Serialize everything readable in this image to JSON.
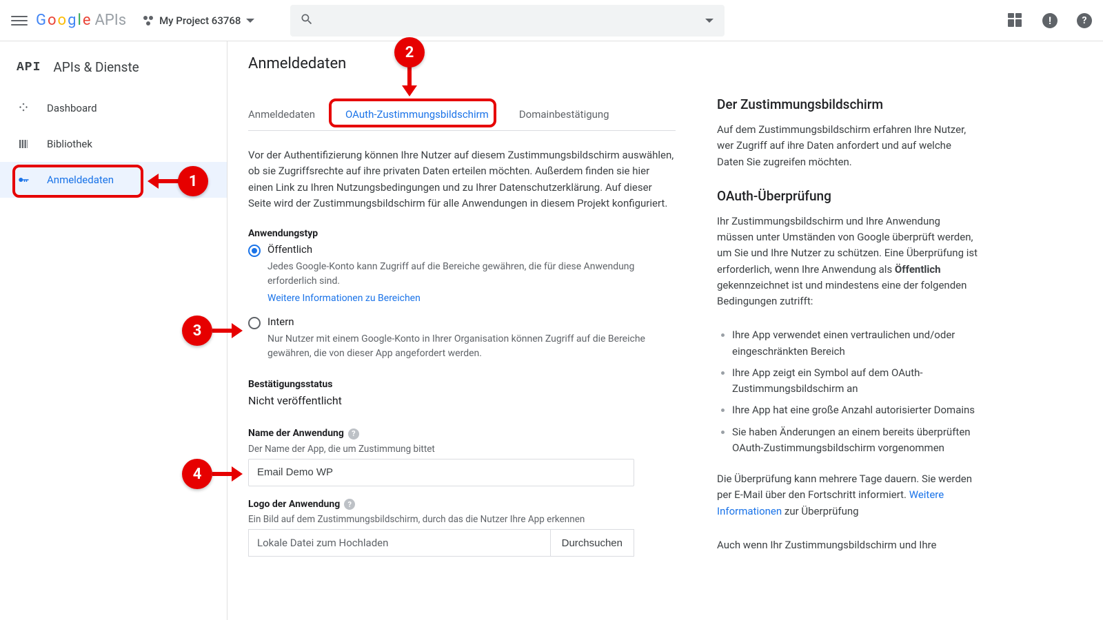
{
  "header": {
    "logo_text": "Google",
    "apis_text": "APIs",
    "project_name": "My Project 63768"
  },
  "sidebar": {
    "section": "APIs & Dienste",
    "items": [
      {
        "label": "Dashboard"
      },
      {
        "label": "Bibliothek"
      },
      {
        "label": "Anmeldedaten"
      }
    ]
  },
  "page": {
    "title": "Anmeldedaten",
    "tabs": [
      {
        "label": "Anmeldedaten"
      },
      {
        "label": "OAuth-Zustimmungsbildschirm"
      },
      {
        "label": "Domainbestätigung"
      }
    ],
    "intro": "Vor der Authentifizierung können Ihre Nutzer auf diesem Zustimmungsbildschirm auswählen, ob sie Zugriffsrechte auf ihre privaten Daten erteilen möchten. Außerdem finden sie hier einen Link zu Ihren Nutzungsbedingungen und zu Ihrer Datenschutzerklärung. Auf dieser Seite wird der Zustimmungsbildschirm für alle Anwendungen in diesem Projekt konfiguriert.",
    "app_type_label": "Anwendungstyp",
    "radio_public": {
      "label": "Öffentlich",
      "desc": "Jedes Google-Konto kann Zugriff auf die Bereiche gewähren, die für diese Anwendung erforderlich sind.",
      "link": "Weitere Informationen zu Bereichen"
    },
    "radio_internal": {
      "label": "Intern",
      "desc": "Nur Nutzer mit einem Google-Konto in Ihrer Organisation können Zugriff auf die Bereiche gewähren, die von dieser App angefordert werden."
    },
    "status_label": "Bestätigungsstatus",
    "status_value": "Nicht veröffentlicht",
    "app_name_label": "Name der Anwendung",
    "app_name_sub": "Der Name der App, die um Zustimmung bittet",
    "app_name_value": "Email Demo WP",
    "logo_label": "Logo der Anwendung",
    "logo_sub": "Ein Bild auf dem Zustimmungsbildschirm, durch das die Nutzer Ihre App erkennen",
    "logo_placeholder": "Lokale Datei zum Hochladen",
    "logo_browse": "Durchsuchen"
  },
  "side": {
    "h1": "Der Zustimmungsbildschirm",
    "p1": "Auf dem Zustimmungsbildschirm erfahren Ihre Nutzer, wer Zugriff auf ihre Daten anfordert und auf welche Daten Sie zugreifen möchten.",
    "h2": "OAuth-Überprüfung",
    "p2a": "Ihr Zustimmungsbildschirm und Ihre Anwendung müssen unter Umständen von Google überprüft werden, um Sie und Ihre Nutzer zu schützen. Eine Überprüfung ist erforderlich, wenn Ihre Anwendung als ",
    "p2b": "Öffentlich",
    "p2c": " gekennzeichnet ist und mindestens eine der folgenden Bedingungen zutrifft:",
    "bullets": [
      "Ihre App verwendet einen vertraulichen und/oder eingeschränkten Bereich",
      "Ihre App zeigt ein Symbol auf dem OAuth-Zustimmungsbildschirm an",
      "Ihre App hat eine große Anzahl autorisierter Domains",
      "Sie haben Änderungen an einem bereits überprüften OAuth-Zustimmungsbildschirm vorgenommen"
    ],
    "p3a": "Die Überprüfung kann mehrere Tage dauern. Sie werden per E-Mail über den Fortschritt informiert. ",
    "p3link": "Weitere Informationen",
    "p3b": " zur Überprüfung",
    "p4": "Auch wenn Ihr Zustimmungsbildschirm und Ihre"
  },
  "annotations": {
    "n1": "1",
    "n2": "2",
    "n3": "3",
    "n4": "4"
  }
}
